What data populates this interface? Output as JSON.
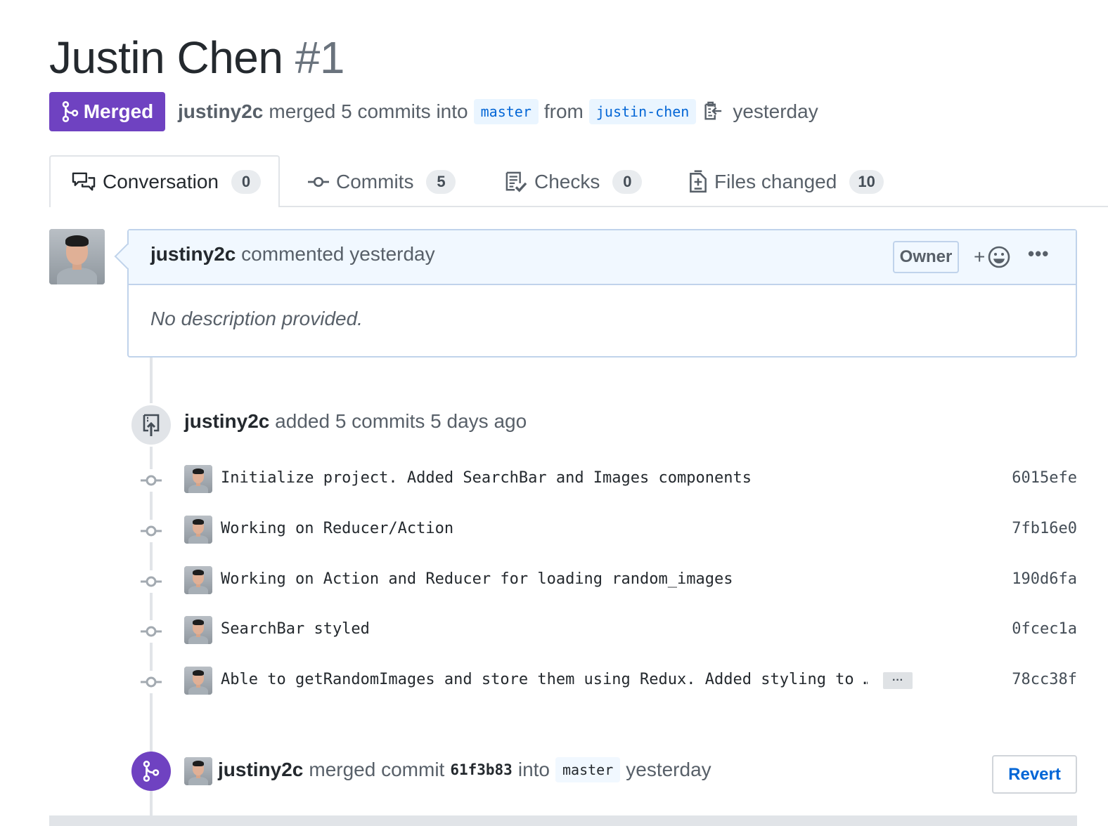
{
  "pr": {
    "title": "Justin Chen",
    "number": "#1",
    "state": "Merged",
    "author": "justiny2c",
    "merged_text": "merged 5 commits into",
    "base_branch": "master",
    "from_text": "from",
    "head_branch": "justin-chen",
    "time": "yesterday"
  },
  "tabs": [
    {
      "label": "Conversation",
      "count": "0",
      "icon": "comment-discussion-icon"
    },
    {
      "label": "Commits",
      "count": "5",
      "icon": "git-commit-icon"
    },
    {
      "label": "Checks",
      "count": "0",
      "icon": "checklist-icon"
    },
    {
      "label": "Files changed",
      "count": "10",
      "icon": "diff-icon"
    }
  ],
  "comment": {
    "author": "justiny2c",
    "action": "commented yesterday",
    "role": "Owner",
    "reaction_plus": "+",
    "more": "•••",
    "body": "No description provided."
  },
  "commit_event": {
    "author": "justiny2c",
    "text": "added 5 commits 5 days ago"
  },
  "commits": [
    {
      "message": "Initialize project. Added SearchBar and Images components",
      "sha": "6015efe"
    },
    {
      "message": "Working on Reducer/Action",
      "sha": "7fb16e0"
    },
    {
      "message": "Working on Action and Reducer for loading random_images",
      "sha": "190d6fa"
    },
    {
      "message": "SearchBar styled",
      "sha": "0fcec1a"
    },
    {
      "message": "Able to getRandomImages and store them using Redux. Added styling to …",
      "sha": "78cc38f",
      "expand": "···"
    }
  ],
  "merge_event": {
    "author": "justiny2c",
    "text": "merged commit",
    "sha": "61f3b83",
    "into": "into",
    "branch": "master",
    "time": "yesterday",
    "revert_label": "Revert"
  },
  "colors": {
    "merged": "#6f42c1",
    "link": "#0366d6",
    "branch_bg": "#eaf5ff",
    "comment_header_bg": "#f1f8ff"
  }
}
